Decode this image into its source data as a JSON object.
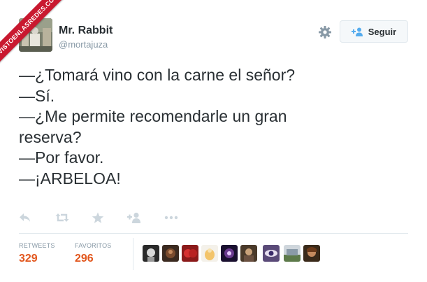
{
  "watermark": {
    "text": "VISTOENLASREDES.COM"
  },
  "user": {
    "display_name": "Mr. Rabbit",
    "handle": "@mortajuza"
  },
  "follow_button": {
    "label": "Seguir"
  },
  "tweet": {
    "lines": [
      "—¿Tomará vino con la carne el señor?",
      "—Sí.",
      "—¿Me permite recomendarle un gran",
      "reserva?",
      "—Por favor.",
      "—¡ARBELOA!"
    ]
  },
  "actions": [
    "reply-icon",
    "retweet-icon",
    "favorite-icon",
    "follow-icon",
    "more-icon"
  ],
  "stats": {
    "retweets_label": "RETWEETS",
    "retweets_count": "329",
    "favorites_label": "FAVORITOS",
    "favorites_count": "296"
  },
  "colors": {
    "accent": "#e2571e",
    "text": "#292f33",
    "muted": "#8899a6",
    "divider": "#e1e8ed",
    "ribbon": "#c9182f"
  },
  "favoriters_count_shown": 10
}
